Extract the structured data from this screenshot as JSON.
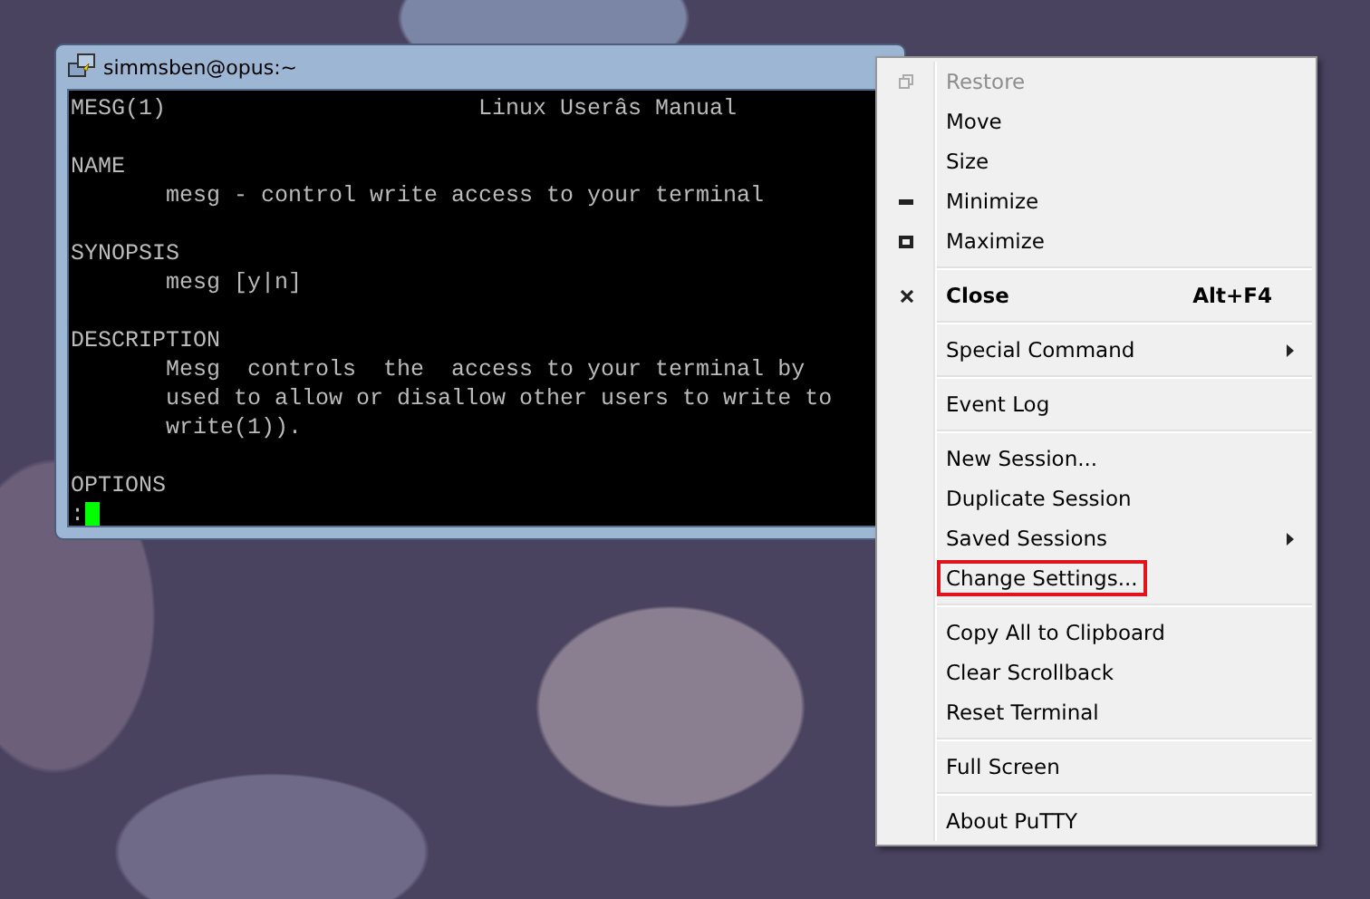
{
  "window": {
    "title": "simmsben@opus:~"
  },
  "terminal": {
    "lines": [
      {
        "text": "MESG(1)                       Linux Userâs Manual",
        "blank_before": false
      },
      {
        "text": "NAME",
        "blank_before": true
      },
      {
        "text": "       mesg - control write access to your terminal",
        "blank_before": false
      },
      {
        "text": "SYNOPSIS",
        "blank_before": true
      },
      {
        "text": "       mesg [y|n]",
        "blank_before": false
      },
      {
        "text": "DESCRIPTION",
        "blank_before": true
      },
      {
        "text": "       Mesg  controls  the  access to your terminal by",
        "blank_before": false
      },
      {
        "text": "       used to allow or disallow other users to write to",
        "blank_before": false
      },
      {
        "text": "       write(1)).",
        "blank_before": false
      },
      {
        "text": "OPTIONS",
        "blank_before": true
      }
    ],
    "prompt": ":",
    "cursor": true
  },
  "menu": {
    "groups": [
      [
        {
          "label": "Restore",
          "kind": "restore",
          "disabled": true
        },
        {
          "label": "Move",
          "disabled": false
        },
        {
          "label": "Size",
          "disabled": false
        },
        {
          "label": "Minimize",
          "kind": "minimize",
          "disabled": false
        },
        {
          "label": "Maximize",
          "kind": "maximize",
          "disabled": false
        }
      ],
      [
        {
          "label": "Close",
          "kind": "close",
          "bold": true,
          "shortcut": "Alt+F4",
          "disabled": false
        }
      ],
      [
        {
          "label": "Special Command",
          "submenu": true,
          "disabled": false
        }
      ],
      [
        {
          "label": "Event Log",
          "disabled": false
        }
      ],
      [
        {
          "label": "New Session...",
          "disabled": false
        },
        {
          "label": "Duplicate Session",
          "disabled": false
        },
        {
          "label": "Saved Sessions",
          "submenu": true,
          "disabled": false
        },
        {
          "label": "Change Settings...",
          "highlighted": true,
          "disabled": false
        }
      ],
      [
        {
          "label": "Copy All to Clipboard",
          "disabled": false
        },
        {
          "label": "Clear Scrollback",
          "disabled": false
        },
        {
          "label": "Reset Terminal",
          "disabled": false
        }
      ],
      [
        {
          "label": "Full Screen",
          "disabled": false
        }
      ],
      [
        {
          "label": "About PuTTY",
          "disabled": false
        }
      ]
    ]
  }
}
